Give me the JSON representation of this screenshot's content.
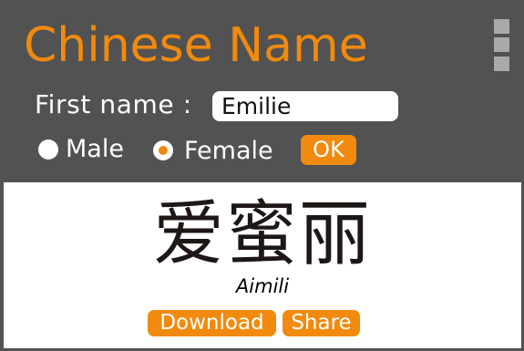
{
  "app": {
    "title": "Chinese Name"
  },
  "form": {
    "first_name_label": "First name :",
    "first_name_value": "Emilie",
    "gender_options": [
      {
        "label": "Male",
        "selected": false
      },
      {
        "label": "Female",
        "selected": true
      }
    ],
    "ok_label": "OK"
  },
  "result": {
    "chinese": "爱蜜丽",
    "pinyin": "Aimili",
    "download_label": "Download",
    "share_label": "Share"
  },
  "icons": {
    "menu": "menu-icon"
  },
  "colors": {
    "accent": "#f18a0e",
    "background": "#525252",
    "panel": "#ffffff",
    "menu_icon": "#a9a9a9"
  }
}
